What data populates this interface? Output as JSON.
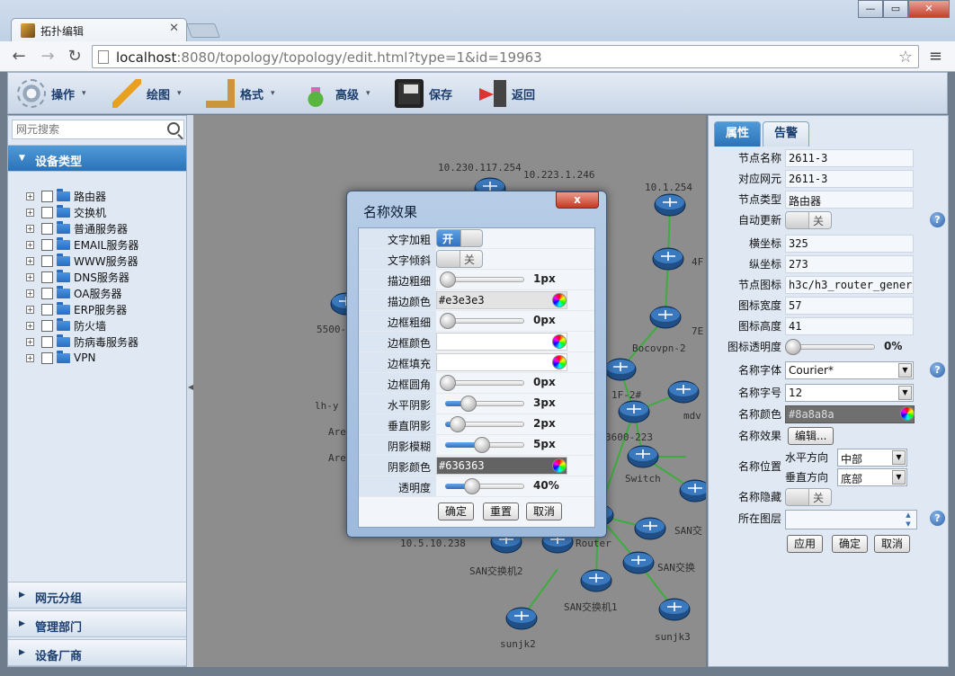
{
  "browser": {
    "tab_title": "拓扑编辑",
    "url_host": "localhost",
    "url_rest": ":8080/topology/topology/edit.html?type=1&id=19963"
  },
  "toolbar": {
    "items": [
      {
        "label": "操作",
        "icon": "gear-icon",
        "dropdown": true
      },
      {
        "label": "绘图",
        "icon": "pencil-icon",
        "dropdown": true
      },
      {
        "label": "格式",
        "icon": "ruler-icon",
        "dropdown": true
      },
      {
        "label": "高级",
        "icon": "flask-icon",
        "dropdown": true
      },
      {
        "label": "保存",
        "icon": "save-icon",
        "dropdown": false
      },
      {
        "label": "返回",
        "icon": "exit-icon",
        "dropdown": false
      }
    ]
  },
  "left_panel": {
    "search_placeholder": "网元搜索",
    "active_section": "设备类型",
    "device_types": [
      "路由器",
      "交换机",
      "普通服务器",
      "EMAIL服务器",
      "WWW服务器",
      "DNS服务器",
      "OA服务器",
      "ERP服务器",
      "防火墙",
      "防病毒服务器",
      "VPN"
    ],
    "sections": [
      "网元分组",
      "管理部门",
      "设备厂商"
    ]
  },
  "canvas": {
    "labels": [
      "10.230.117.254",
      "10.223.1.246",
      "10.1.254",
      "4F",
      "5500-",
      "7E",
      "Bocovpn-2",
      "lh-y",
      "Are",
      "Are",
      "1F-2#",
      "mdv",
      "3600-223",
      "Switch",
      "Router",
      "10.5.10.238",
      "SAN交换机2",
      "SAN交",
      "SAN交换",
      "SAN交换机1",
      "sunjk2",
      "sunjk3"
    ]
  },
  "properties": {
    "tabs": [
      "属性",
      "告警"
    ],
    "node_name_label": "节点名称",
    "node_name": "2611-3",
    "ne_label": "对应网元",
    "ne": "2611-3",
    "type_label": "节点类型",
    "type": "路由器",
    "auto_update_label": "自动更新",
    "auto_update": "关",
    "x_label": "横坐标",
    "x": "325",
    "y_label": "纵坐标",
    "y": "273",
    "icon_label": "节点图标",
    "icon": "h3c/h3_router_general.s",
    "icon_width_label": "图标宽度",
    "icon_width": "57",
    "icon_height_label": "图标高度",
    "icon_height": "41",
    "opacity_label": "图标透明度",
    "opacity": "0%",
    "font_label": "名称字体",
    "font": "Courier*",
    "font_size_label": "名称字号",
    "font_size": "12",
    "name_color_label": "名称颜色",
    "name_color": "#8a8a8a",
    "effect_label": "名称效果",
    "effect_button": "编辑...",
    "position_label": "名称位置",
    "h_dir_label": "水平方向",
    "h_dir": "中部",
    "v_dir_label": "垂直方向",
    "v_dir": "底部",
    "hidden_label": "名称隐藏",
    "hidden": "关",
    "layer_label": "所在图层",
    "apply": "应用",
    "ok": "确定",
    "cancel": "取消"
  },
  "dialog": {
    "title": "名称效果",
    "close": "x",
    "bold_label": "文字加粗",
    "bold": "开",
    "italic_label": "文字倾斜",
    "italic": "关",
    "stroke_width_label": "描边粗细",
    "stroke_width": "1px",
    "stroke_width_level": 0,
    "stroke_color_label": "描边颜色",
    "stroke_color": "#e3e3e3",
    "border_width_label": "边框粗细",
    "border_width": "0px",
    "border_width_level": 0,
    "border_color_label": "边框颜色",
    "border_color": "",
    "border_fill_label": "边框填充",
    "border_fill": "",
    "border_radius_label": "边框圆角",
    "border_radius": "0px",
    "border_radius_level": 0,
    "h_shadow_label": "水平阴影",
    "h_shadow": "3px",
    "h_shadow_level": 0.3,
    "v_shadow_label": "垂直阴影",
    "v_shadow": "2px",
    "v_shadow_level": 0.15,
    "blur_label": "阴影模糊",
    "blur": "5px",
    "blur_level": 0.5,
    "shadow_color_label": "阴影颜色",
    "shadow_color": "#636363",
    "transparency_label": "透明度",
    "transparency": "40%",
    "transparency_level": 0.35,
    "ok": "确定",
    "reset": "重置",
    "cancel": "取消"
  },
  "colors": {
    "accent": "#2b73b8",
    "canvas_bg": "#8d8d8d",
    "link": "#3cad3c"
  }
}
